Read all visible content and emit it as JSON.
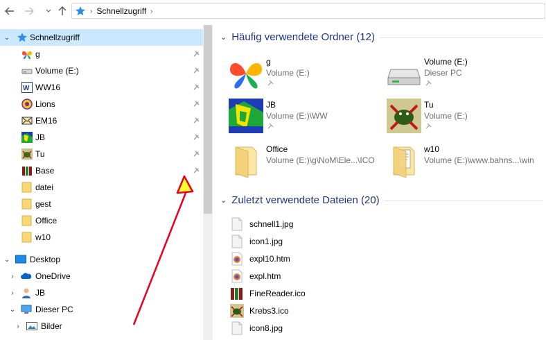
{
  "address": {
    "breadcrumb": "Schnellzugriff"
  },
  "nav": {
    "items": [
      {
        "label": "Schnellzugriff",
        "icon": "star-icon",
        "pinned": false
      },
      {
        "label": "g",
        "icon": "butterfly-icon",
        "pinned": true
      },
      {
        "label": "Volume (E:)",
        "icon": "drive-icon",
        "pinned": true
      },
      {
        "label": "WW16",
        "icon": "word-icon",
        "pinned": true
      },
      {
        "label": "Lions",
        "icon": "lions-icon",
        "pinned": true
      },
      {
        "label": "EM16",
        "icon": "mail-icon",
        "pinned": true
      },
      {
        "label": "JB",
        "icon": "jb-icon",
        "pinned": true
      },
      {
        "label": "Tu",
        "icon": "tu-icon",
        "pinned": true
      },
      {
        "label": "Base",
        "icon": "books-icon",
        "pinned": true
      },
      {
        "label": "datei",
        "icon": "folder-icon",
        "pinned": false
      },
      {
        "label": "gest",
        "icon": "folder-icon",
        "pinned": false
      },
      {
        "label": "Office",
        "icon": "folder-icon",
        "pinned": false
      },
      {
        "label": "w10",
        "icon": "folder-icon",
        "pinned": false
      },
      {
        "label": "Desktop",
        "icon": "desktop-icon",
        "pinned": false
      },
      {
        "label": "OneDrive",
        "icon": "cloud-icon",
        "pinned": false
      },
      {
        "label": "JB",
        "icon": "user-icon",
        "pinned": false
      },
      {
        "label": "Dieser PC",
        "icon": "pc-icon",
        "pinned": false
      },
      {
        "label": "Bilder",
        "icon": "pictures-icon",
        "pinned": false
      }
    ]
  },
  "frequent": {
    "header": "Häufig verwendete Ordner (12)",
    "tiles": [
      {
        "name": "g",
        "location": "Volume (E:)",
        "pinned": true
      },
      {
        "name": "Volume (E:)",
        "location": "Dieser PC",
        "pinned": true
      },
      {
        "name": "JB",
        "location": "Volume (E:)\\WW",
        "pinned": true
      },
      {
        "name": "Tu",
        "location": "Volume (E:)",
        "pinned": true
      },
      {
        "name": "Office",
        "location": "Volume (E:)\\g\\NoM\\Ele...\\ICO",
        "pinned": false
      },
      {
        "name": "w10",
        "location": "Volume (E:)\\www.bahns...\\win",
        "pinned": false
      }
    ]
  },
  "recent": {
    "header": "Zuletzt verwendete Dateien (20)",
    "files": [
      {
        "name": "schnell1.jpg",
        "icon": "image-file-icon"
      },
      {
        "name": "icon1.jpg",
        "icon": "image-file-icon"
      },
      {
        "name": "expl10.htm",
        "icon": "firefox-icon"
      },
      {
        "name": "expl.htm",
        "icon": "firefox-icon"
      },
      {
        "name": "FineReader.ico",
        "icon": "books-icon"
      },
      {
        "name": "Krebs3.ico",
        "icon": "crab-icon"
      },
      {
        "name": "icon8.jpg",
        "icon": "image-file-icon"
      }
    ]
  },
  "colors": {
    "selection": "#cce8ff",
    "group_header": "#1e3287",
    "annotation_arrow": "#e8001c",
    "annotation_fill": "#ffff33"
  }
}
